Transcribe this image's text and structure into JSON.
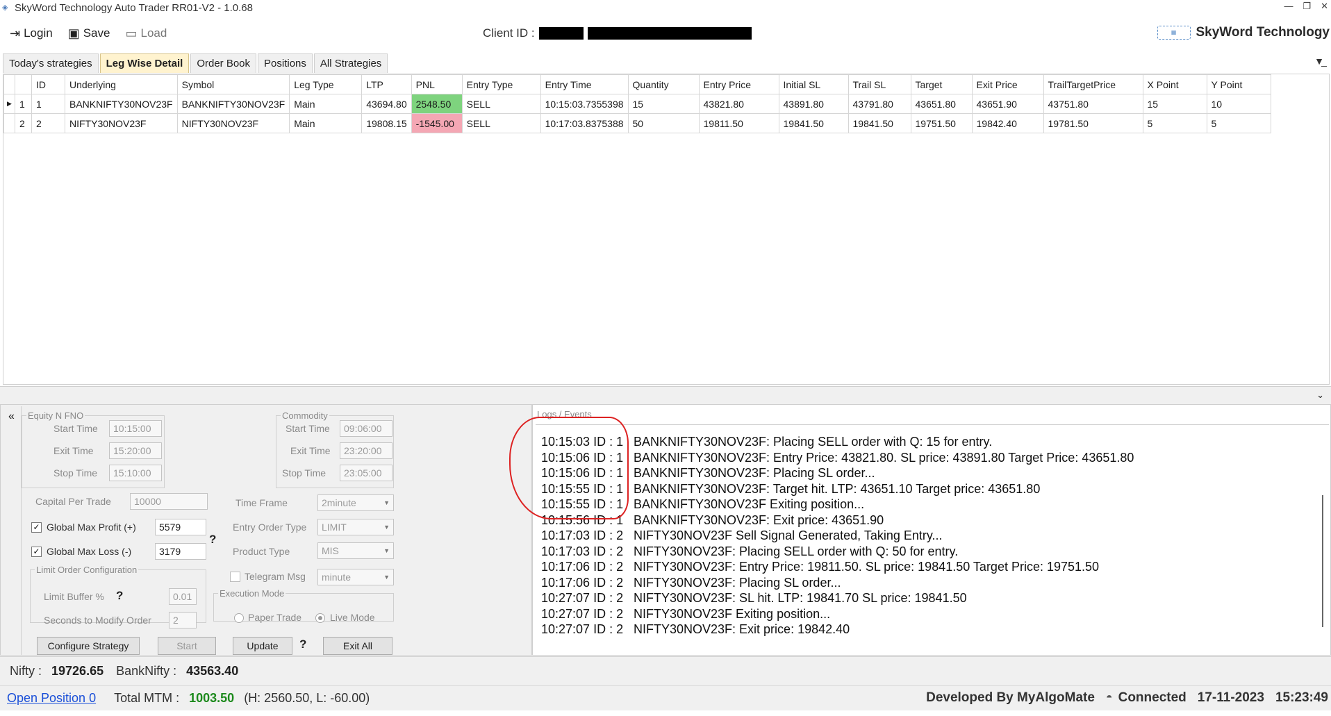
{
  "window": {
    "title": "SkyWord Technology Auto Trader RR01-V2 - 1.0.68",
    "controls": [
      "—",
      "❐",
      "✕"
    ]
  },
  "toolbar": {
    "login_label": "Login",
    "save_label": "Save",
    "load_label": "Load",
    "client_id_label": "Client ID :",
    "brand_name": "SkyWord Technology"
  },
  "tabs": [
    {
      "label": "Today's strategies"
    },
    {
      "label": "Leg Wise Detail"
    },
    {
      "label": "Order Book"
    },
    {
      "label": "Positions"
    },
    {
      "label": "All Strategies"
    }
  ],
  "grid": {
    "columns": [
      "ID",
      "Underlying",
      "Symbol",
      "Leg Type",
      "LTP",
      "PNL",
      "Entry Type",
      "Entry Time",
      "Quantity",
      "Entry Price",
      "Initial SL",
      "Trail SL",
      "Target",
      "Exit Price",
      "TrailTargetPrice",
      "X Point",
      "Y Point"
    ],
    "rows": [
      {
        "num": "1",
        "marker": "▶",
        "cells": [
          "1",
          "BANKNIFTY30NOV23F",
          "BANKNIFTY30NOV23F",
          "Main",
          "43694.80",
          "2548.50",
          "SELL",
          "10:15:03.7355398",
          "15",
          "43821.80",
          "43891.80",
          "43791.80",
          "43651.80",
          "43651.90",
          "43751.80",
          "15",
          "10"
        ],
        "pnl_status": "positive"
      },
      {
        "num": "2",
        "marker": "",
        "cells": [
          "2",
          "NIFTY30NOV23F",
          "NIFTY30NOV23F",
          "Main",
          "19808.15",
          "-1545.00",
          "SELL",
          "10:17:03.8375388",
          "50",
          "19811.50",
          "19841.50",
          "19841.50",
          "19751.50",
          "19842.40",
          "19781.50",
          "5",
          "5"
        ],
        "pnl_status": "negative"
      }
    ]
  },
  "config": {
    "collapse_icon": "«",
    "equity": {
      "legend": "Equity N FNO",
      "start_time_label": "Start Time",
      "start_time": "10:15:00",
      "exit_time_label": "Exit Time",
      "exit_time": "15:20:00",
      "stop_time_label": "Stop Time",
      "stop_time": "15:10:00"
    },
    "commodity": {
      "legend": "Commodity",
      "start_time_label": "Start Time",
      "start_time": "09:06:00",
      "exit_time_label": "Exit Time",
      "exit_time": "23:20:00",
      "stop_time_label": "Stop Time",
      "stop_time": "23:05:00"
    },
    "capital_label": "Capital Per Trade",
    "capital": "10000",
    "time_frame_label": "Time Frame",
    "time_frame": "2minute",
    "max_profit_label": "Global Max Profit (+)",
    "max_profit": "5579",
    "max_loss_label": "Global Max Loss (-)",
    "max_loss": "3179",
    "entry_order_type_label": "Entry Order Type",
    "entry_order_type": "LIMIT",
    "product_type_label": "Product Type",
    "product_type": "MIS",
    "limit_order_legend": "Limit Order Configuration",
    "limit_buffer_label": "Limit Buffer %",
    "limit_buffer": "0.01",
    "seconds_modify_label": "Seconds to Modify Order",
    "seconds_modify": "2",
    "telegram_label": "Telegram Msg",
    "telegram_unit": "minute",
    "execution_legend": "Execution Mode",
    "paper_trade_label": "Paper Trade",
    "live_mode_label": "Live Mode",
    "help_mark": "?",
    "buttons": {
      "configure": "Configure Strategy",
      "start": "Start",
      "update": "Update",
      "exit_all": "Exit All"
    }
  },
  "logs": {
    "legend": "Logs / Events",
    "lines": [
      {
        "ts": "10:15:03 ID : 1",
        "msg": "BANKNIFTY30NOV23F: Placing SELL order with Q: 15 for entry."
      },
      {
        "ts": "10:15:06 ID : 1",
        "msg": "BANKNIFTY30NOV23F: Entry Price: 43821.80. SL price: 43891.80 Target Price: 43651.80"
      },
      {
        "ts": "10:15:06 ID : 1",
        "msg": "BANKNIFTY30NOV23F: Placing SL order..."
      },
      {
        "ts": "10:15:55 ID : 1",
        "msg": "BANKNIFTY30NOV23F: Target hit. LTP: 43651.10 Target price: 43651.80"
      },
      {
        "ts": "10:15:55 ID : 1",
        "msg": "BANKNIFTY30NOV23F Exiting position..."
      },
      {
        "ts": "10:15:56 ID : 1",
        "msg": "BANKNIFTY30NOV23F: Exit price: 43651.90"
      },
      {
        "ts": "10:17:03 ID : 2",
        "msg": "NIFTY30NOV23F Sell Signal Generated, Taking Entry..."
      },
      {
        "ts": "10:17:03 ID : 2",
        "msg": "NIFTY30NOV23F: Placing SELL order with Q: 50 for entry."
      },
      {
        "ts": "10:17:06 ID : 2",
        "msg": "NIFTY30NOV23F: Entry Price: 19811.50. SL price: 19841.50 Target Price: 19751.50"
      },
      {
        "ts": "10:17:06 ID : 2",
        "msg": "NIFTY30NOV23F: Placing SL order..."
      },
      {
        "ts": "10:27:07 ID : 2",
        "msg": "NIFTY30NOV23F: SL hit. LTP: 19841.70 SL price: 19841.50"
      },
      {
        "ts": "10:27:07 ID : 2",
        "msg": "NIFTY30NOV23F Exiting position..."
      },
      {
        "ts": "10:27:07 ID : 2",
        "msg": "NIFTY30NOV23F: Exit price: 19842.40"
      }
    ]
  },
  "status": {
    "nifty_label": "Nifty :",
    "nifty": "19726.65",
    "banknifty_label": "BankNifty :",
    "banknifty": "43563.40",
    "open_position": "Open Position 0",
    "total_mtm_label": "Total MTM :",
    "total_mtm": "1003.50",
    "hl": "(H: 2560.50, L: -60.00)",
    "developer": "Developed By MyAlgoMate",
    "connection": "Connected",
    "date": "17-11-2023",
    "time": "15:23:49"
  },
  "colors": {
    "pnl_positive": "#7ed37e",
    "pnl_negative": "#f4a7b4",
    "mtm_text": "#1d8a1d",
    "active_tab": "#fff3cf"
  }
}
